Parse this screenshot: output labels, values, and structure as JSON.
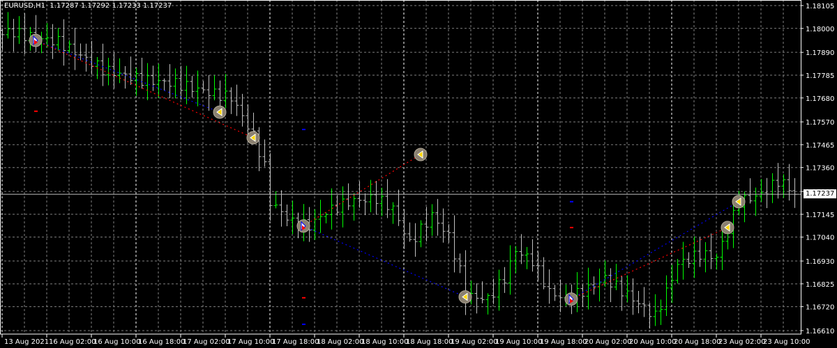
{
  "header": {
    "symbol": "EURUSD,H1",
    "ohlc": "1.17287 1.17292 1.17233 1.17237"
  },
  "current_price": "1.17237",
  "colors": {
    "background": "#000000",
    "grid": "#808080",
    "up_bar": "#00ff00",
    "down_bar": "#c0c0c0",
    "buy_line": "#0000ff",
    "sell_line": "#ff0000",
    "axis": "#ffffff"
  },
  "chart_data": {
    "type": "bar",
    "subtype": "ohlc",
    "timeframe": "H1",
    "grid": true,
    "ylim": [
      1.1661,
      1.18105
    ],
    "yticks": [
      "1.18105",
      "1.18000",
      "1.17890",
      "1.17785",
      "1.17680",
      "1.17570",
      "1.17465",
      "1.17360",
      "1.17250",
      "1.17145",
      "1.17040",
      "1.16930",
      "1.16825",
      "1.16720",
      "1.16610"
    ],
    "xticks": [
      {
        "bar": 0,
        "label": "13 Aug 2021"
      },
      {
        "bar": 8,
        "label": "16 Aug 02:00"
      },
      {
        "bar": 16,
        "label": "16 Aug 10:00"
      },
      {
        "bar": 24,
        "label": "16 Aug 18:00"
      },
      {
        "bar": 32,
        "label": "17 Aug 02:00"
      },
      {
        "bar": 40,
        "label": "17 Aug 10:00"
      },
      {
        "bar": 48,
        "label": "17 Aug 18:00"
      },
      {
        "bar": 56,
        "label": "18 Aug 02:00"
      },
      {
        "bar": 64,
        "label": "18 Aug 10:00"
      },
      {
        "bar": 72,
        "label": "18 Aug 18:00"
      },
      {
        "bar": 80,
        "label": "19 Aug 02:00"
      },
      {
        "bar": 88,
        "label": "19 Aug 10:00"
      },
      {
        "bar": 96,
        "label": "19 Aug 18:00"
      },
      {
        "bar": 104,
        "label": "20 Aug 02:00"
      },
      {
        "bar": 112,
        "label": "20 Aug 10:00"
      },
      {
        "bar": 120,
        "label": "20 Aug 18:00"
      },
      {
        "bar": 128,
        "label": "23 Aug 02:00"
      },
      {
        "bar": 136,
        "label": "23 Aug 10:00"
      }
    ],
    "close_path": [
      [
        0,
        1.17971
      ],
      [
        1,
        1.17987
      ],
      [
        6,
        1.17955
      ],
      [
        10,
        1.17939
      ],
      [
        18,
        1.17811
      ],
      [
        25,
        1.17763
      ],
      [
        31,
        1.17747
      ],
      [
        38,
        1.17699
      ],
      [
        41,
        1.17683
      ],
      [
        45,
        1.17507
      ],
      [
        47,
        1.17363
      ],
      [
        48,
        1.17203
      ],
      [
        52,
        1.17107
      ],
      [
        55,
        1.17091
      ],
      [
        58,
        1.17155
      ],
      [
        62,
        1.17203
      ],
      [
        67,
        1.17219
      ],
      [
        70,
        1.17171
      ],
      [
        73,
        1.17011
      ],
      [
        75,
        1.17075
      ],
      [
        77,
        1.17139
      ],
      [
        80,
        1.17043
      ],
      [
        82,
        1.16883
      ],
      [
        83,
        1.16771
      ],
      [
        87,
        1.16755
      ],
      [
        90,
        1.16851
      ],
      [
        92,
        1.16979
      ],
      [
        95,
        1.16931
      ],
      [
        98,
        1.16787
      ],
      [
        101,
        1.16755
      ],
      [
        105,
        1.16803
      ],
      [
        108,
        1.16851
      ],
      [
        113,
        1.16755
      ],
      [
        117,
        1.16675
      ],
      [
        119,
        1.16787
      ],
      [
        121,
        1.16915
      ],
      [
        125,
        1.16963
      ],
      [
        128,
        1.16947
      ],
      [
        130,
        1.17075
      ],
      [
        132,
        1.17203
      ],
      [
        136,
        1.17235
      ],
      [
        139,
        1.17299
      ],
      [
        141,
        1.17267
      ],
      [
        142,
        1.17237
      ]
    ],
    "trades": [
      {
        "open": {
          "bar": 6,
          "price": 1.17945
        },
        "close": {
          "bar": 39,
          "price": 1.17615
        },
        "side": "buy"
      },
      {
        "open": {
          "bar": 6,
          "price": 1.17945
        },
        "close": {
          "bar": 45,
          "price": 1.17497
        },
        "side": "sell"
      },
      {
        "open": {
          "bar": 54,
          "price": 1.17091
        },
        "close": {
          "bar": 75,
          "price": 1.1742
        },
        "side": "sell"
      },
      {
        "open": {
          "bar": 54,
          "price": 1.17091
        },
        "close": {
          "bar": 83,
          "price": 1.16765
        },
        "side": "buy"
      },
      {
        "open": {
          "bar": 102,
          "price": 1.16755
        },
        "close": {
          "bar": 132,
          "price": 1.17203
        },
        "side": "buy"
      },
      {
        "open": {
          "bar": 102,
          "price": 1.16755
        },
        "close": {
          "bar": 130,
          "price": 1.17084
        },
        "side": "sell"
      }
    ],
    "levels": [
      {
        "bar": 6,
        "price": 1.17619,
        "side": "sell"
      },
      {
        "bar": 54,
        "price": 1.17535,
        "side": "buy"
      },
      {
        "bar": 54,
        "price": 1.16761,
        "side": "sell"
      },
      {
        "bar": 54,
        "price": 1.16639,
        "side": "buy"
      },
      {
        "bar": 102,
        "price": 1.17203,
        "side": "buy"
      },
      {
        "bar": 102,
        "price": 1.17084,
        "side": "sell"
      }
    ]
  }
}
